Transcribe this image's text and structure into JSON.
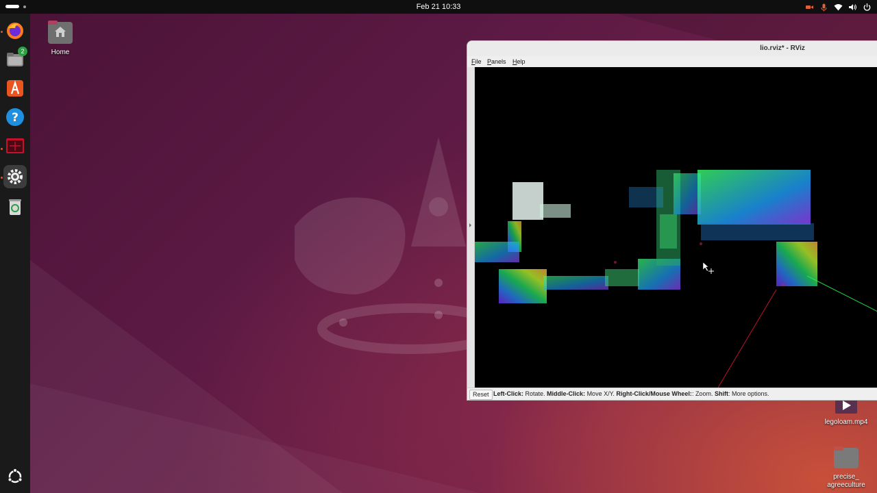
{
  "topbar": {
    "datetime": "Feb 21  10:33"
  },
  "tray_icons": [
    "camera-icon",
    "microphone-icon",
    "wifi-icon",
    "volume-icon",
    "power-icon"
  ],
  "dock": {
    "items": [
      {
        "name": "firefox-icon",
        "running": true
      },
      {
        "name": "files-icon",
        "badge": "2"
      },
      {
        "name": "app-center-icon"
      },
      {
        "name": "help-icon"
      },
      {
        "name": "terminal-icon",
        "running": true
      },
      {
        "name": "settings-icon",
        "running": true,
        "active": true
      },
      {
        "name": "trash-icon"
      }
    ],
    "show_apps": "ubuntu-logo-icon"
  },
  "desktop": {
    "home_label": "Home",
    "video_label": "legoloam.mp4",
    "folder_label_line1": "precise_",
    "folder_label_line2": "agreeculture"
  },
  "rviz": {
    "title": "lio.rviz* - RViz",
    "menu": {
      "file": "File",
      "panels": "Panels",
      "help": "Help"
    },
    "status": {
      "reset": "Reset",
      "left_click": "Left-Click:",
      "left_action": " Rotate. ",
      "middle_click": "Middle-Click:",
      "middle_action": " Move X/Y. ",
      "right_click": "Right-Click/Mouse Wheel:",
      "right_action": ": Zoom. ",
      "shift": "Shift",
      "shift_action": ": More options."
    }
  },
  "colors": {
    "accent": "#e95420",
    "topbar": "#0f0f0f",
    "dock": "#1a1a1a",
    "viewport": "#000000"
  }
}
